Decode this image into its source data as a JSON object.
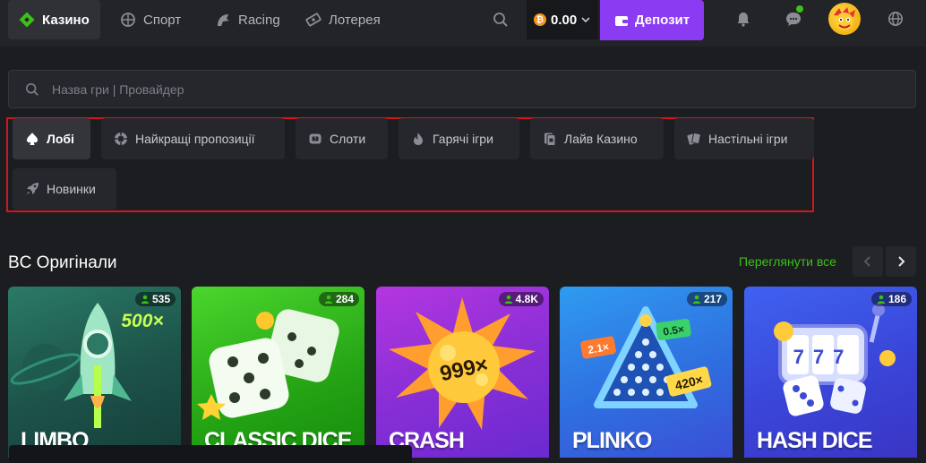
{
  "nav": {
    "items": [
      {
        "label": "Казино",
        "icon": "casino-icon"
      },
      {
        "label": "Спорт",
        "icon": "sport-icon"
      },
      {
        "label": "Racing",
        "icon": "racing-icon"
      },
      {
        "label": "Лотерея",
        "icon": "lottery-icon"
      }
    ],
    "balance": "0.00",
    "currency_icon": "bitcoin-icon",
    "deposit_label": "Депозит"
  },
  "search": {
    "placeholder": "Назва гри | Провайдер"
  },
  "categories": [
    {
      "label": "Лобі",
      "icon": "spade-icon",
      "active": true
    },
    {
      "label": "Найкращі пропозиції",
      "icon": "chip-icon"
    },
    {
      "label": "Слоти",
      "icon": "slot-icon"
    },
    {
      "label": "Гарячі ігри",
      "icon": "fire-icon"
    },
    {
      "label": "Лайв Казино",
      "icon": "live-cards-icon"
    },
    {
      "label": "Настільні ігри",
      "icon": "table-cards-icon"
    },
    {
      "label": "Новинки",
      "icon": "rocket-icon"
    }
  ],
  "section": {
    "title": "BC Оригінали",
    "see_all": "Переглянути все"
  },
  "games": [
    {
      "title": "LIMBO",
      "players": "535",
      "art_text": "500×"
    },
    {
      "title": "CLASSIC DICE",
      "players": "284"
    },
    {
      "title": "CRASH",
      "players": "4.8K",
      "art_text": "999×"
    },
    {
      "title": "PLINKO",
      "players": "217",
      "art_text": [
        "2.1×",
        "0.5×",
        "420×"
      ]
    },
    {
      "title": "HASH DICE",
      "players": "186",
      "art_text": "777"
    }
  ],
  "colors": {
    "accent_green": "#3bc117",
    "deposit_purple": "#8b3cf2",
    "highlight_red": "#d0171f"
  }
}
